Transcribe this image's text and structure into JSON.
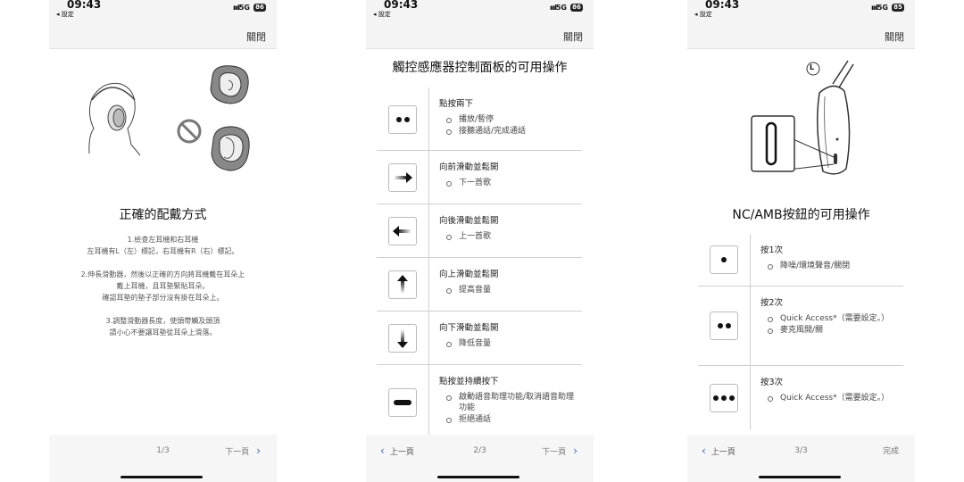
{
  "status": {
    "time": "09:43",
    "back_label": "◂ 設定",
    "signal": "ıııl",
    "network": "5G"
  },
  "phone1": {
    "battery": "86",
    "close_label": "關閉",
    "title": "正確的配戴方式",
    "instructions": [
      "1.檢查左耳機和右耳機\n左耳機有L（左）標記，右耳機有R（右）標記。",
      "2.伸長滑動器，然後以正確的方向將耳機戴在耳朵上\n戴上耳機，且耳墊緊貼耳朵。\n確認耳墊的墊子部分沒有掛在耳朵上。",
      "3.調整滑動器長度，使頭帶觸及頭頂\n請小心不要讓耳墊從耳朵上滑落。"
    ],
    "footer": {
      "page": "1/3",
      "next": "下一頁"
    }
  },
  "phone2": {
    "battery": "86",
    "close_label": "關閉",
    "title": "觸控感應器控制面板的可用操作",
    "rows": [
      {
        "icon": "double-tap-icon",
        "label": "點按兩下",
        "items": [
          "播放/暫停",
          "接聽通話/完成通話"
        ]
      },
      {
        "icon": "swipe-forward-icon",
        "label": "向前滑動並鬆開",
        "items": [
          "下一首歌"
        ]
      },
      {
        "icon": "swipe-back-icon",
        "label": "向後滑動並鬆開",
        "items": [
          "上一首歌"
        ]
      },
      {
        "icon": "swipe-up-icon",
        "label": "向上滑動並鬆開",
        "items": [
          "提高音量"
        ]
      },
      {
        "icon": "swipe-down-icon",
        "label": "向下滑動並鬆開",
        "items": [
          "降低音量"
        ]
      },
      {
        "icon": "tap-hold-icon",
        "label": "點按並持續按下",
        "items": [
          "啟動語音助理功能/取消語音助理功能",
          "拒絕通話"
        ]
      }
    ],
    "footer": {
      "prev": "上一頁",
      "page": "2/3",
      "next": "下一頁"
    }
  },
  "phone3": {
    "battery": "85",
    "close_label": "關閉",
    "title": "NC/AMB按鈕的可用操作",
    "diagram_label": "L",
    "rows": [
      {
        "icon": "single-press-icon",
        "label": "按1次",
        "items": [
          "降噪/環境聲音/關閉"
        ]
      },
      {
        "icon": "double-press-icon",
        "label": "按2次",
        "items": [
          "Quick Access*（需要設定。）",
          "麥克風開/關"
        ]
      },
      {
        "icon": "triple-press-icon",
        "label": "按3次",
        "items": [
          "Quick Access*（需要設定。）"
        ]
      }
    ],
    "footer": {
      "prev": "上一頁",
      "page": "3/3",
      "done": "完成"
    }
  }
}
